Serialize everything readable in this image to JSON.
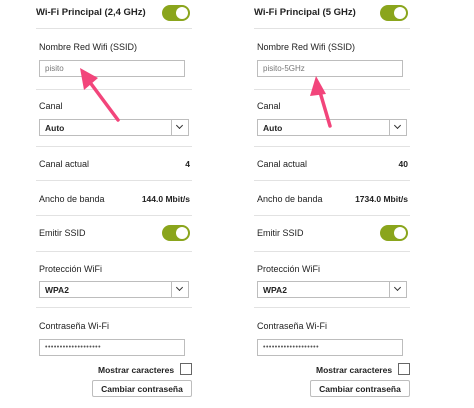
{
  "panels": [
    {
      "title": "Wi-Fi Principal (2,4 GHz)",
      "ssid_label": "Nombre Red Wifi (SSID)",
      "ssid_value": "pisito",
      "channel_label": "Canal",
      "channel_value": "Auto",
      "current_channel_label": "Canal actual",
      "current_channel_value": "4",
      "bandwidth_label": "Ancho de banda",
      "bandwidth_value": "144.0 Mbit/s",
      "broadcast_label": "Emitir SSID",
      "protection_label": "Protección WiFi",
      "protection_value": "WPA2",
      "password_label": "Contraseña Wi-Fi",
      "password_value": "•••••••••••••••••••",
      "show_chars_label": "Mostrar caracteres",
      "change_password_label": "Cambiar contraseña"
    },
    {
      "title": "Wi-Fi Principal (5 GHz)",
      "ssid_label": "Nombre Red Wifi (SSID)",
      "ssid_value": "pisito-5GHz",
      "channel_label": "Canal",
      "channel_value": "Auto",
      "current_channel_label": "Canal actual",
      "current_channel_value": "40",
      "bandwidth_label": "Ancho de banda",
      "bandwidth_value": "1734.0 Mbit/s",
      "broadcast_label": "Emitir SSID",
      "protection_label": "Protección WiFi",
      "protection_value": "WPA2",
      "password_label": "Contraseña Wi-Fi",
      "password_value": "•••••••••••••••••••",
      "show_chars_label": "Mostrar caracteres",
      "change_password_label": "Cambiar contraseña"
    }
  ],
  "colors": {
    "toggle_on": "#8aa51c",
    "annotation_arrow": "#f2457b"
  },
  "icons": [
    "toggle-switch",
    "chevron-down-icon",
    "annotation-arrow-icon"
  ]
}
